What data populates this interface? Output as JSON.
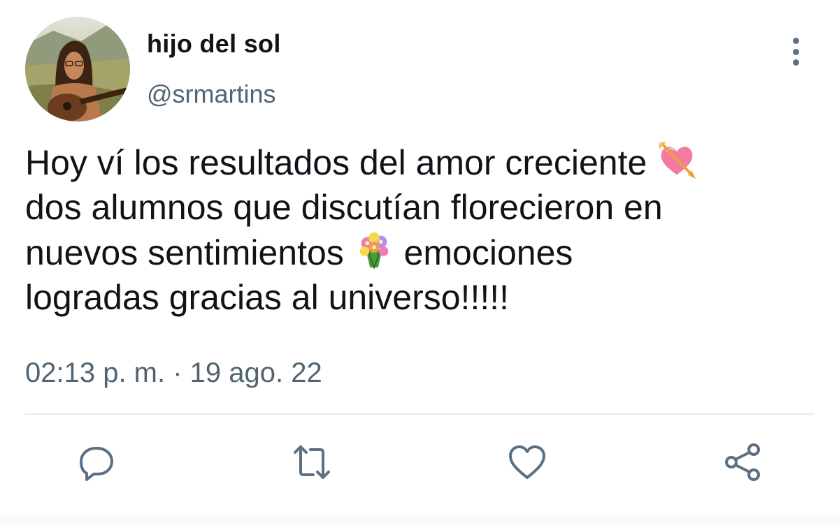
{
  "user": {
    "display_name": "hijo del sol",
    "handle": "@srmartins",
    "avatar_icon": "profile-photo"
  },
  "tweet": {
    "lines": [
      {
        "text": "Hoy ví los resultados del amor creciente ",
        "emoji": "heart-with-arrow"
      },
      {
        "text": "dos alumnos que discutían florecieron en"
      },
      {
        "text": "nuevos sentimientos ",
        "emoji": "bouquet",
        "after": " emociones"
      },
      {
        "text": "logradas gracias al universo!!!!!"
      }
    ],
    "timestamp": "02:13 p. m. · 19 ago. 22"
  },
  "actions": [
    {
      "name": "reply",
      "icon": "reply-icon"
    },
    {
      "name": "retweet",
      "icon": "retweet-icon"
    },
    {
      "name": "like",
      "icon": "heart-icon"
    },
    {
      "name": "share",
      "icon": "share-icon"
    }
  ],
  "colors": {
    "text": "#0f1419",
    "secondary": "#536471",
    "icon": "#5b7083",
    "divider": "#e6ecf0"
  }
}
